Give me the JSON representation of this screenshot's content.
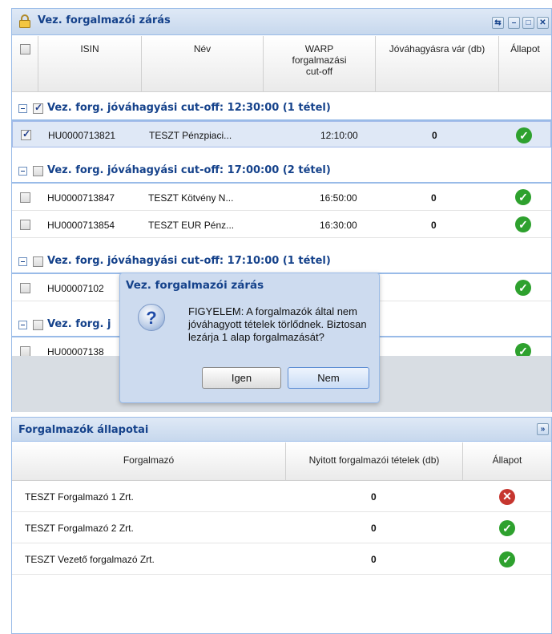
{
  "window": {
    "title": "Vez. forgalmazói zárás",
    "columns": [
      "ISIN",
      "Név",
      "WARP forgalmazási cut-off",
      "Jóváhagyásra vár (db)",
      "Állapot"
    ]
  },
  "groups": [
    {
      "label": "Vez. forg. jóváhagyási cut-off: 12:30:00 (1 tétel)",
      "checked": true,
      "rows": [
        {
          "isin": "HU0000713821",
          "nev": "TESZT Pénzpiaci...",
          "cutoff": "12:10:00",
          "count": "0",
          "status": "ok",
          "checked": true
        }
      ]
    },
    {
      "label": "Vez. forg. jóváhagyási cut-off: 17:00:00 (2 tétel)",
      "checked": false,
      "rows": [
        {
          "isin": "HU0000713847",
          "nev": "TESZT Kötvény N...",
          "cutoff": "16:50:00",
          "count": "0",
          "status": "ok",
          "checked": false
        },
        {
          "isin": "HU0000713854",
          "nev": "TESZT EUR Pénz...",
          "cutoff": "16:30:00",
          "count": "0",
          "status": "ok",
          "checked": false
        }
      ]
    },
    {
      "label": "Vez. forg. jóváhagyási cut-off: 17:10:00 (1 tétel)",
      "checked": false,
      "rows": [
        {
          "isin": "HU00007102",
          "status": "ok",
          "checked": false
        }
      ]
    },
    {
      "label": "Vez. forg. j",
      "checked": false,
      "rows": [
        {
          "isin": "HU00007138",
          "status": "ok",
          "checked": false
        }
      ]
    }
  ],
  "dialog": {
    "title": "Vez. forgalmazói zárás",
    "message": "FIGYELEM: A forgalmazók által nem jóváhagyott tételek törlődnek. Biztosan lezárja 1 alap forgalmazását?",
    "yes_label": "Igen",
    "no_label": "Nem"
  },
  "panel": {
    "title": "Forgalmazók állapotai",
    "columns": [
      "Forgalmazó",
      "Nyitott forgalmazói tételek (db)",
      "Állapot"
    ],
    "rows": [
      {
        "name": "TESZT Forgalmazó 1 Zrt.",
        "count": "0",
        "status": "error"
      },
      {
        "name": "TESZT Forgalmazó 2 Zrt.",
        "count": "0",
        "status": "ok"
      },
      {
        "name": "TESZT Vezető forgalmazó Zrt.",
        "count": "0",
        "status": "ok"
      }
    ]
  },
  "colors": {
    "accent": "#15428b",
    "ok": "#2ea12e",
    "error": "#c6362f",
    "border": "#99bbe8"
  }
}
